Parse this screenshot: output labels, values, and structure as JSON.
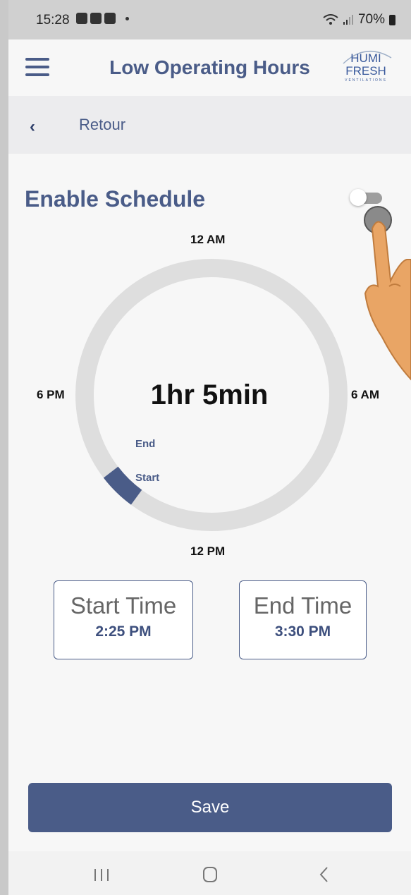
{
  "status_bar": {
    "time": "15:28",
    "battery": "70%"
  },
  "header": {
    "title": "Low Operating Hours",
    "logo_text": "HUMI\nFRESH",
    "logo_sub": "VENTILATIONS"
  },
  "back": {
    "label": "Retour"
  },
  "schedule": {
    "title": "Enable Schedule",
    "enabled": false,
    "dial_labels": {
      "top": "12 AM",
      "right": "6 AM",
      "bottom": "12 PM",
      "left": "6 PM"
    },
    "duration": "1hr 5min",
    "end_label": "End",
    "start_label": "Start"
  },
  "start_time": {
    "label": "Start Time",
    "value": "2:25 PM"
  },
  "end_time": {
    "label": "End Time",
    "value": "3:30 PM"
  },
  "save_label": "Save",
  "colors": {
    "accent": "#4a5c88",
    "ring": "#dedede",
    "background": "#f7f7f7"
  }
}
